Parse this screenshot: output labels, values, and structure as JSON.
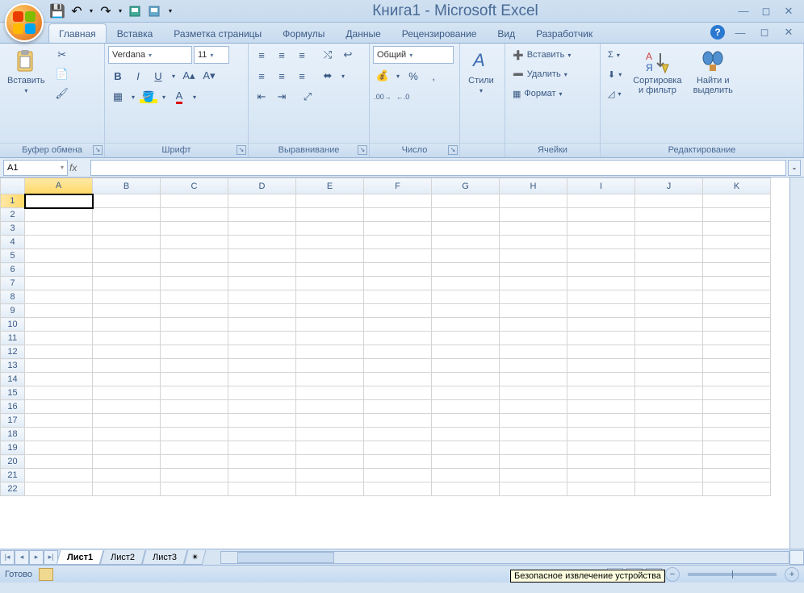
{
  "title": "Книга1 - Microsoft Excel",
  "qat_icons": [
    "save-icon",
    "undo-icon",
    "redo-icon",
    "quickprint-icon",
    "preview-icon"
  ],
  "tabs": [
    {
      "label": "Главная",
      "active": true
    },
    {
      "label": "Вставка"
    },
    {
      "label": "Разметка страницы"
    },
    {
      "label": "Формулы"
    },
    {
      "label": "Данные"
    },
    {
      "label": "Рецензирование"
    },
    {
      "label": "Вид"
    },
    {
      "label": "Разработчик"
    }
  ],
  "ribbon": {
    "clipboard": {
      "label": "Буфер обмена",
      "paste": "Вставить"
    },
    "font": {
      "label": "Шрифт",
      "name": "Verdana",
      "size": "11"
    },
    "alignment": {
      "label": "Выравнивание"
    },
    "number": {
      "label": "Число",
      "format": "Общий"
    },
    "styles": {
      "label": "",
      "btn": "Стили"
    },
    "cells": {
      "label": "Ячейки",
      "insert": "Вставить",
      "delete": "Удалить",
      "format": "Формат"
    },
    "editing": {
      "label": "Редактирование",
      "sort": "Сортировка\nи фильтр",
      "find": "Найти и\nвыделить"
    }
  },
  "name_box": "A1",
  "columns": [
    "A",
    "B",
    "C",
    "D",
    "E",
    "F",
    "G",
    "H",
    "I",
    "J",
    "K"
  ],
  "row_count": 22,
  "active_cell": {
    "col": "A",
    "row": 1
  },
  "sheets": [
    {
      "name": "Лист1",
      "active": true
    },
    {
      "name": "Лист2"
    },
    {
      "name": "Лист3"
    }
  ],
  "status": "Готово",
  "tooltip": "Безопасное извлечение устройства"
}
